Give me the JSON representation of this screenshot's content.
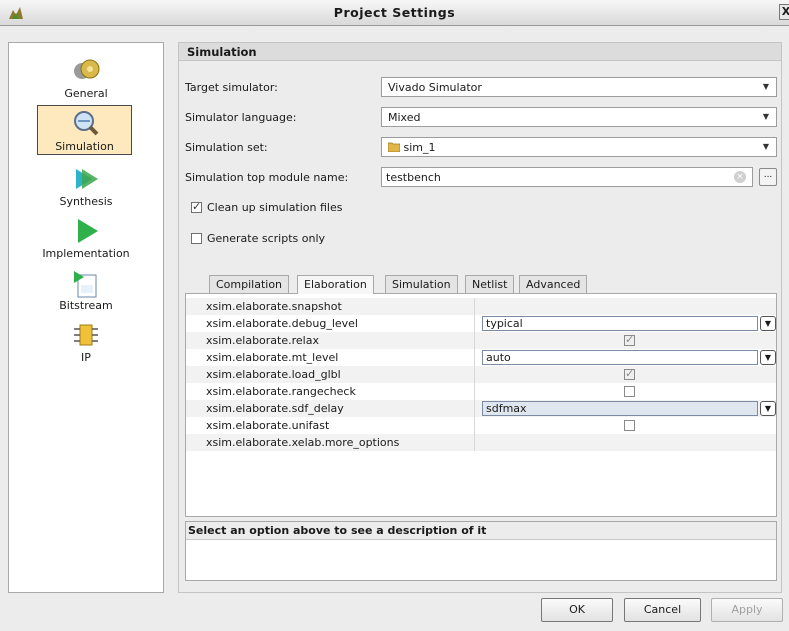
{
  "window": {
    "title": "Project Settings",
    "close_glyph": "X"
  },
  "nav": {
    "items": [
      {
        "label": "General",
        "icon": "general-icon"
      },
      {
        "label": "Simulation",
        "icon": "magnifier-icon",
        "selected": true
      },
      {
        "label": "Synthesis",
        "icon": "synthesis-icon"
      },
      {
        "label": "Implementation",
        "icon": "play-icon"
      },
      {
        "label": "Bitstream",
        "icon": "bitstream-icon"
      },
      {
        "label": "IP",
        "icon": "ip-chip-icon"
      }
    ]
  },
  "panel": {
    "title": "Simulation",
    "target_simulator": {
      "label": "Target simulator:",
      "value": "Vivado Simulator"
    },
    "simulator_language": {
      "label": "Simulator language:",
      "value": "Mixed"
    },
    "simulation_set": {
      "label": "Simulation set:",
      "value": "sim_1"
    },
    "top_module": {
      "label": "Simulation top module name:",
      "value": "testbench"
    },
    "clean_up": {
      "label": "Clean up simulation files",
      "checked": true
    },
    "generate_scripts": {
      "label": "Generate scripts only",
      "checked": false
    }
  },
  "tabs": [
    {
      "label": "Compilation",
      "active": false
    },
    {
      "label": "Elaboration",
      "active": true
    },
    {
      "label": "Simulation",
      "active": false
    },
    {
      "label": "Netlist",
      "active": false
    },
    {
      "label": "Advanced",
      "active": false
    }
  ],
  "options": [
    {
      "key": "xsim.elaborate.snapshot",
      "type": "text",
      "value": ""
    },
    {
      "key": "xsim.elaborate.debug_level",
      "type": "combo",
      "value": "typical"
    },
    {
      "key": "xsim.elaborate.relax",
      "type": "check",
      "checked": true
    },
    {
      "key": "xsim.elaborate.mt_level",
      "type": "combo",
      "value": "auto"
    },
    {
      "key": "xsim.elaborate.load_glbl",
      "type": "check",
      "checked": true
    },
    {
      "key": "xsim.elaborate.rangecheck",
      "type": "check",
      "checked": false
    },
    {
      "key": "xsim.elaborate.sdf_delay",
      "type": "combo",
      "value": "sdfmax",
      "selected": true
    },
    {
      "key": "xsim.elaborate.unifast",
      "type": "check",
      "checked": false
    },
    {
      "key": "xsim.elaborate.xelab.more_options",
      "type": "text",
      "value": ""
    }
  ],
  "description": {
    "header": "Select an option above to see a description of it"
  },
  "buttons": {
    "ok": "OK",
    "cancel": "Cancel",
    "apply": "Apply"
  },
  "browse_glyph": "...",
  "dropdown_glyph": "▼"
}
